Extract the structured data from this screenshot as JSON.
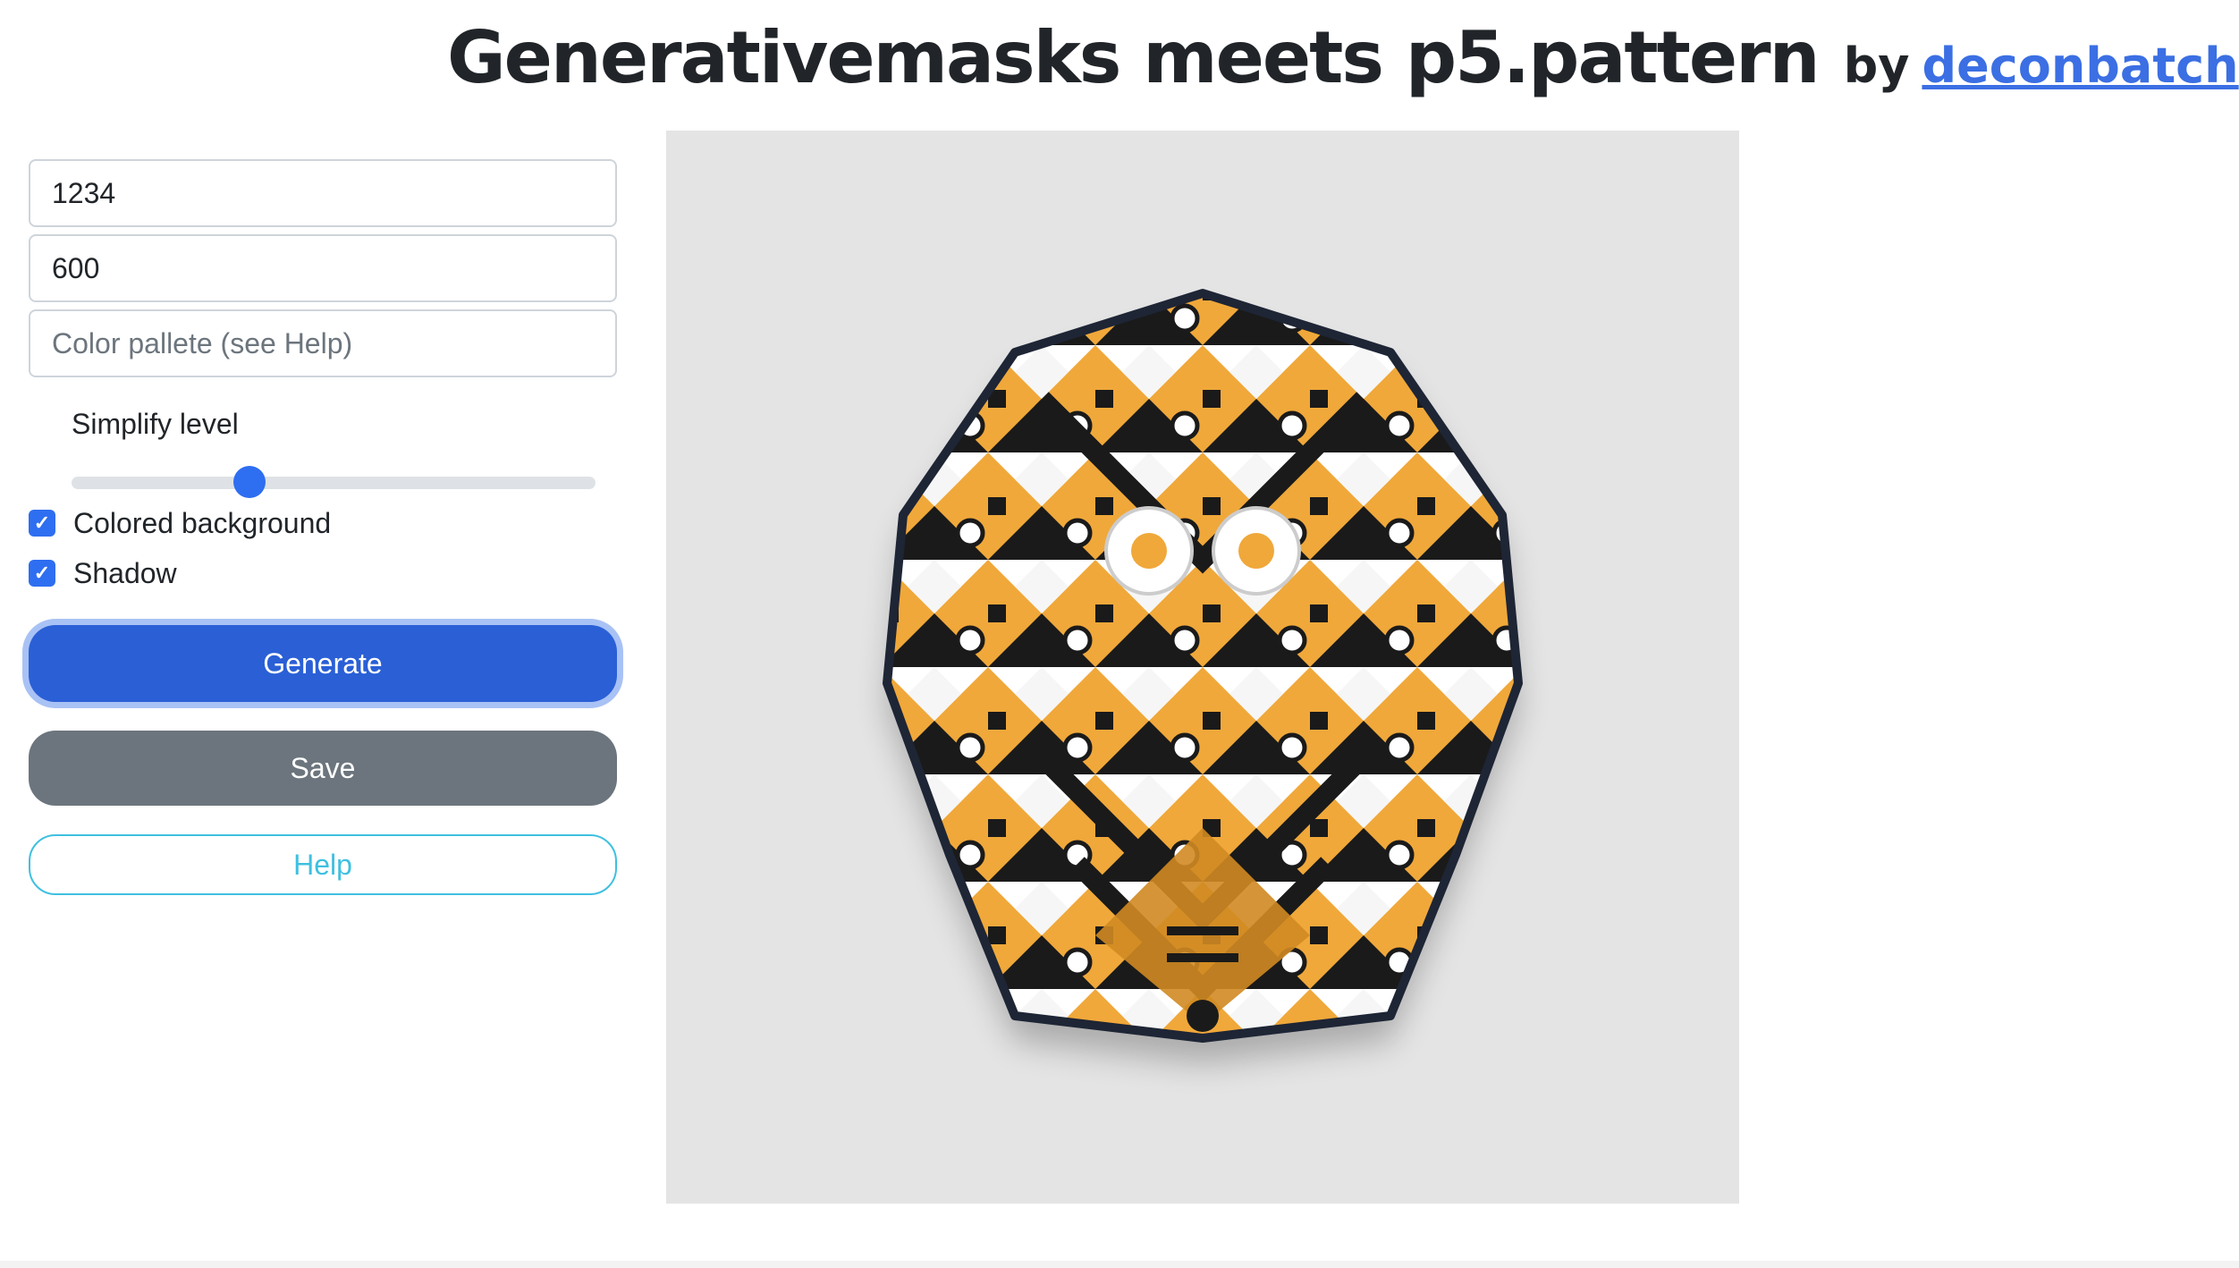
{
  "header": {
    "title": "Generativemasks meets p5.pattern",
    "by": "by",
    "author": "deconbatch"
  },
  "controls": {
    "seed_value": "1234",
    "size_value": "600",
    "palette_placeholder": "Color pallete (see Help)",
    "simplify_label": "Simplify level",
    "simplify_level": 0.34,
    "colored_background_label": "Colored background",
    "colored_background_checked": true,
    "shadow_label": "Shadow",
    "shadow_checked": true,
    "generate_label": "Generate",
    "save_label": "Save",
    "help_label": "Help"
  },
  "canvas": {
    "description_colors": {
      "background": "#e4e4e4",
      "accent": "#f0a83a",
      "outline": "#1e2535"
    }
  },
  "icons": {
    "checkbox": "check-icon"
  }
}
